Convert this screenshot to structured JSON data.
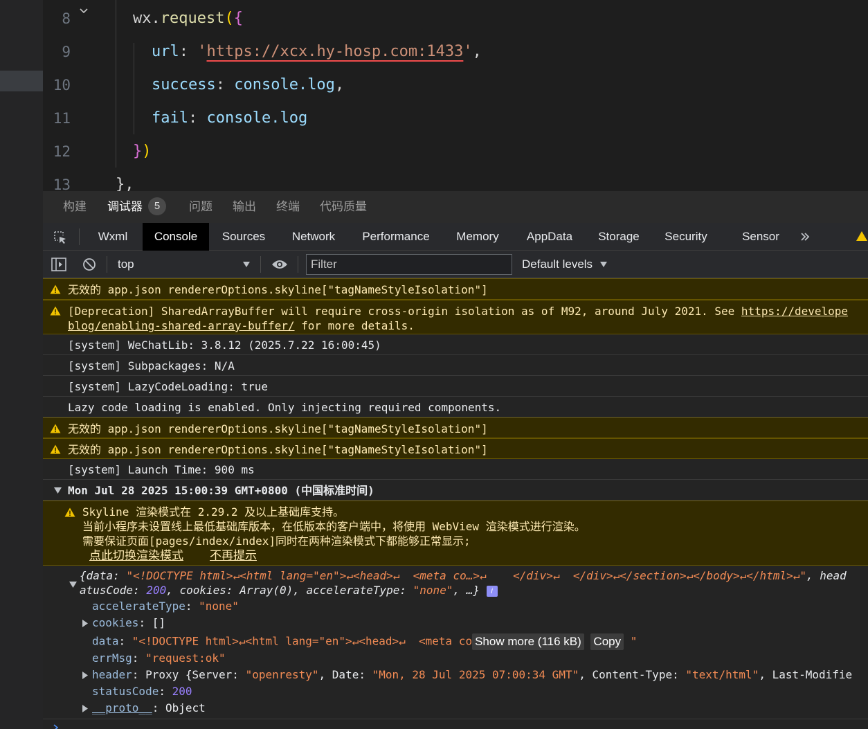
{
  "editor": {
    "lines": [
      {
        "num": "8",
        "text": "wx.request({"
      },
      {
        "num": "9",
        "text": "url: 'https://xcx.hy-hosp.com:1433',"
      },
      {
        "num": "10",
        "text": "success: console.log,"
      },
      {
        "num": "11",
        "text": "fail: console.log"
      },
      {
        "num": "12",
        "text": "})"
      },
      {
        "num": "13",
        "text": "},"
      }
    ],
    "tokens": {
      "wx": "wx.",
      "request": "request",
      "paren_open": "(",
      "brace_open": "{",
      "url_key": "url",
      "colon": ": ",
      "quote": "'",
      "url_val": "https://xcx.hy-hosp.com:1433",
      "comma": ",",
      "success_key": "success",
      "console": "console.",
      "log": "log",
      "fail_key": "fail",
      "close": "}",
      "close_paren": ")"
    }
  },
  "panel_tabs": [
    {
      "label": "构建"
    },
    {
      "label": "调试器",
      "badge": "5"
    },
    {
      "label": "问题"
    },
    {
      "label": "输出"
    },
    {
      "label": "终端"
    },
    {
      "label": "代码质量"
    }
  ],
  "devtools_tabs": [
    "Wxml",
    "Console",
    "Sources",
    "Network",
    "Performance",
    "Memory",
    "AppData",
    "Storage",
    "Security",
    "Sensor"
  ],
  "filter_bar": {
    "context": "top",
    "filter_placeholder": "Filter",
    "levels": "Default levels"
  },
  "console": {
    "messages": [
      {
        "type": "warn",
        "text": "无效的 app.json rendererOptions.skyline[\"tagNameStyleIsolation\"]"
      },
      {
        "type": "warn",
        "line1_pre": "[Deprecation] SharedArrayBuffer will require cross-origin isolation as of M92, around July 2021. See ",
        "line1_link": "https://develope",
        "line2_link": "blog/enabling-shared-array-buffer/",
        "line2_post": " for more details."
      },
      {
        "type": "log",
        "text": "[system] WeChatLib: 3.8.12 (2025.7.22 16:00:45)"
      },
      {
        "type": "log",
        "text": "[system] Subpackages: N/A"
      },
      {
        "type": "log",
        "text": "[system] LazyCodeLoading: true"
      },
      {
        "type": "log",
        "text": "Lazy code loading is enabled. Only injecting required components."
      },
      {
        "type": "warn",
        "text": "无效的 app.json rendererOptions.skyline[\"tagNameStyleIsolation\"]"
      },
      {
        "type": "warn",
        "text": "无效的 app.json rendererOptions.skyline[\"tagNameStyleIsolation\"]"
      },
      {
        "type": "log",
        "text": "[system] Launch Time: 900 ms"
      }
    ],
    "group_header": "Mon Jul 28 2025 15:00:39 GMT+0800 (中国标准时间)",
    "skyline_warning": {
      "line1": "Skyline 渲染模式在 2.29.2 及以上基础库支持。",
      "line2": "当前小程序未设置线上最低基础库版本，在低版本的客户端中，将使用 WebView 渲染模式进行渲染。",
      "line3": "需要保证页面[pages/index/index]同时在两种渲染模式下都能够正常显示;",
      "link1": "点此切换渲染模式",
      "link2": "不再提示"
    },
    "object": {
      "summary1_a": "{data: ",
      "summary1_data": "\"<!DOCTYPE html>↵<html lang=\"en\">↵<head>↵  <meta co…>↵    </div>↵  </div>↵</section>↵</body>↵</html>↵\"",
      "summary1_b": ", head",
      "summary2_a": "atusCode: ",
      "summary2_code": "200",
      "summary2_b": ", cookies: Array(0), accelerateType: ",
      "summary2_accel": "\"none\"",
      "summary2_c": ", …}",
      "info_icon": "i",
      "props": [
        {
          "key": "accelerateType",
          "value": "\"none\""
        },
        {
          "key": "cookies",
          "value": "[]"
        },
        {
          "key": "data",
          "value": "\"<!DOCTYPE html>↵<html lang=\"en\">↵<head>↵  <meta co"
        },
        {
          "key": "errMsg",
          "value": "\"request:ok\""
        },
        {
          "key": "header",
          "value_prefix": "Proxy {Server: ",
          "server": "\"openresty\"",
          "date_key": ", Date: ",
          "date": "\"Mon, 28 Jul 2025 07:00:34 GMT\"",
          "ct_key": ", Content-Type: ",
          "ct": "\"text/html\"",
          "tail": ", Last-Modifie"
        },
        {
          "key": "statusCode",
          "value": "200"
        },
        {
          "key": "__proto__",
          "value": "Object"
        }
      ],
      "show_more": "Show more (116 kB)",
      "copy": "Copy",
      "data_tail": "\""
    }
  },
  "colors": {
    "editor_bg": "#1e1e1e",
    "warn_bg": "#332b00",
    "warn_text": "#fce8b2",
    "string": "#f28b54",
    "number": "#9980ff",
    "key": "#9bbbdc"
  }
}
